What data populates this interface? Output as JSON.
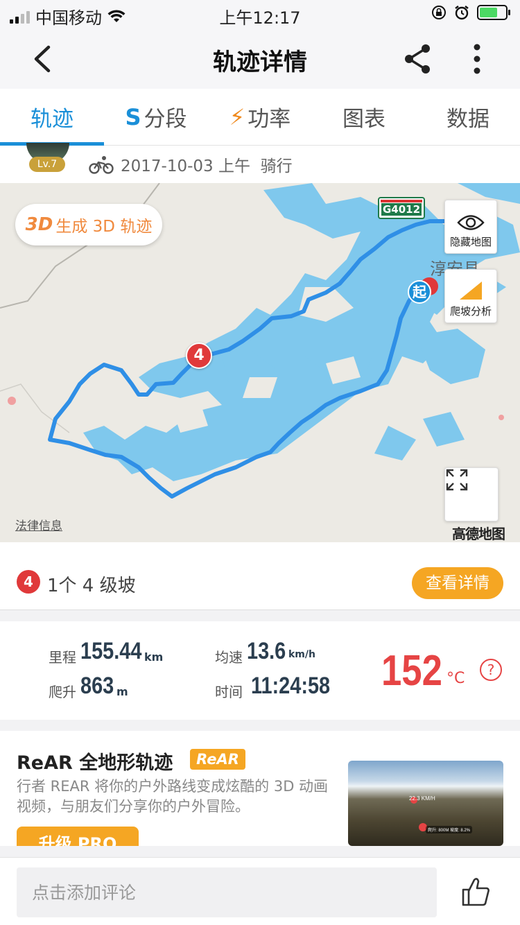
{
  "status_bar": {
    "carrier": "中国移动",
    "time": "上午12:17"
  },
  "nav": {
    "title": "轨迹详情",
    "back_icon": "chevron-left-icon",
    "share_icon": "share-icon",
    "more_icon": "more-vertical-icon"
  },
  "tabs": [
    {
      "label": "轨迹",
      "icon": "",
      "active": true
    },
    {
      "label": "分段",
      "icon": "S",
      "active": false
    },
    {
      "label": "功率",
      "icon": "⚡",
      "active": false
    },
    {
      "label": "图表",
      "icon": "",
      "active": false
    },
    {
      "label": "数据",
      "icon": "",
      "active": false
    }
  ],
  "info": {
    "level": "Lv.7",
    "date": "2017-10-03 上午",
    "activity": "骑行"
  },
  "map": {
    "btn_3d_prefix": "3D",
    "btn_3d_label": "生成 3D 轨迹",
    "hide_map_label": "隐藏地图",
    "climb_analysis_label": "爬坡分析",
    "legal": "法律信息",
    "provider": "高德地图",
    "road_sign": "G4012",
    "town_label": "淳安县",
    "start_marker": "起",
    "climb_marker": "4",
    "colors": {
      "water": "#7fc8ed",
      "land": "#eceae4",
      "track": "#2f8fe6"
    }
  },
  "climb": {
    "badge": "4",
    "text": "1个 4 级坡",
    "detail_button": "查看详情"
  },
  "stats": {
    "distance_label": "里程",
    "distance_value": "155.44",
    "distance_unit": "km",
    "avg_speed_label": "均速",
    "avg_speed_value": "13.6",
    "avg_speed_unit": "km/h",
    "climb_label": "爬升",
    "climb_value": "863",
    "climb_unit": "m",
    "time_label": "时间",
    "time_value": "11:24:58",
    "temp_value": "152",
    "temp_unit": "°C",
    "help": "?"
  },
  "promo": {
    "title": "ReAR 全地形轨迹",
    "badge": "ReAR",
    "description": "行者 REAR 将你的户外路线变成炫酷的 3D 动画视频，与朋友们分享你的户外冒险。",
    "upgrade_button": "升级 PRO",
    "image_speed": "22.3 KM/H",
    "image_climb": "爬升: 800M 坡度: 8.2%"
  },
  "bottom": {
    "comment_placeholder": "点击添加评论",
    "like_icon": "thumbs-up-icon"
  }
}
